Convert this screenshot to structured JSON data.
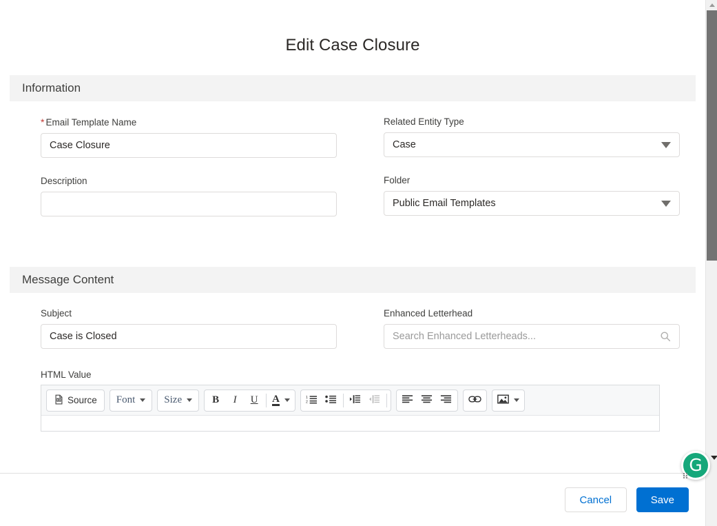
{
  "page": {
    "title": "Edit Case Closure"
  },
  "sections": {
    "information": {
      "header": "Information",
      "fields": {
        "email_template_name": {
          "label": "Email Template Name",
          "required_marker": "*",
          "value": "Case Closure"
        },
        "related_entity_type": {
          "label": "Related Entity Type",
          "value": "Case"
        },
        "description": {
          "label": "Description",
          "value": ""
        },
        "folder": {
          "label": "Folder",
          "value": "Public Email Templates"
        }
      }
    },
    "message_content": {
      "header": "Message Content",
      "fields": {
        "subject": {
          "label": "Subject",
          "value": "Case is Closed"
        },
        "enhanced_letterhead": {
          "label": "Enhanced Letterhead",
          "value": "",
          "placeholder": "Search Enhanced Letterheads...",
          "icon": "search-icon"
        },
        "html_value": {
          "label": "HTML Value",
          "body": ""
        }
      }
    }
  },
  "editor_toolbar": {
    "groups": [
      {
        "name": "source-group",
        "buttons": [
          {
            "name": "source",
            "label": "Source",
            "icon": "source-code-icon",
            "has_caret": false,
            "disabled": false
          }
        ]
      },
      {
        "name": "font-group",
        "buttons": [
          {
            "name": "font",
            "label": "Font",
            "icon": "",
            "has_caret": true,
            "disabled": false
          }
        ]
      },
      {
        "name": "size-group",
        "buttons": [
          {
            "name": "size",
            "label": "Size",
            "icon": "",
            "has_caret": true,
            "disabled": false
          }
        ]
      },
      {
        "name": "text-format-group",
        "buttons": [
          {
            "name": "bold",
            "label": "B",
            "icon": "bold-icon",
            "has_caret": false,
            "disabled": false
          },
          {
            "name": "italic",
            "label": "I",
            "icon": "italic-icon",
            "has_caret": false,
            "disabled": false
          },
          {
            "name": "underline",
            "label": "U",
            "icon": "underline-icon",
            "has_caret": false,
            "disabled": false
          },
          {
            "name": "text-color",
            "label": "A",
            "icon": "text-color-icon",
            "has_caret": true,
            "disabled": false
          }
        ]
      },
      {
        "name": "list-indent-group",
        "buttons": [
          {
            "name": "numbered-list",
            "label": "",
            "icon": "numbered-list-icon",
            "has_caret": false,
            "disabled": false
          },
          {
            "name": "bulleted-list",
            "label": "",
            "icon": "bulleted-list-icon",
            "has_caret": false,
            "disabled": false
          },
          {
            "name": "indent",
            "label": "",
            "icon": "indent-icon",
            "has_caret": false,
            "disabled": false
          },
          {
            "name": "outdent",
            "label": "",
            "icon": "outdent-icon",
            "has_caret": false,
            "disabled": true
          }
        ]
      },
      {
        "name": "align-group",
        "buttons": [
          {
            "name": "align-left",
            "label": "",
            "icon": "align-left-icon",
            "has_caret": false,
            "disabled": false
          },
          {
            "name": "align-center",
            "label": "",
            "icon": "align-center-icon",
            "has_caret": false,
            "disabled": false
          },
          {
            "name": "align-right",
            "label": "",
            "icon": "align-right-icon",
            "has_caret": false,
            "disabled": false
          }
        ]
      },
      {
        "name": "link-group",
        "buttons": [
          {
            "name": "insert-link",
            "label": "",
            "icon": "link-icon",
            "has_caret": false,
            "disabled": false
          }
        ]
      },
      {
        "name": "image-group",
        "buttons": [
          {
            "name": "insert-image",
            "label": "",
            "icon": "image-icon",
            "has_caret": true,
            "disabled": false
          }
        ]
      }
    ]
  },
  "footer": {
    "cancel_label": "Cancel",
    "save_label": "Save"
  },
  "extension": {
    "grammarly_label": "G"
  },
  "colors": {
    "accent_blue": "#0070d2",
    "required_red": "#c23934",
    "section_header_bg": "#f3f3f3",
    "toolbar_bg": "#f7f8f9",
    "grammarly_green": "#15a77a"
  }
}
